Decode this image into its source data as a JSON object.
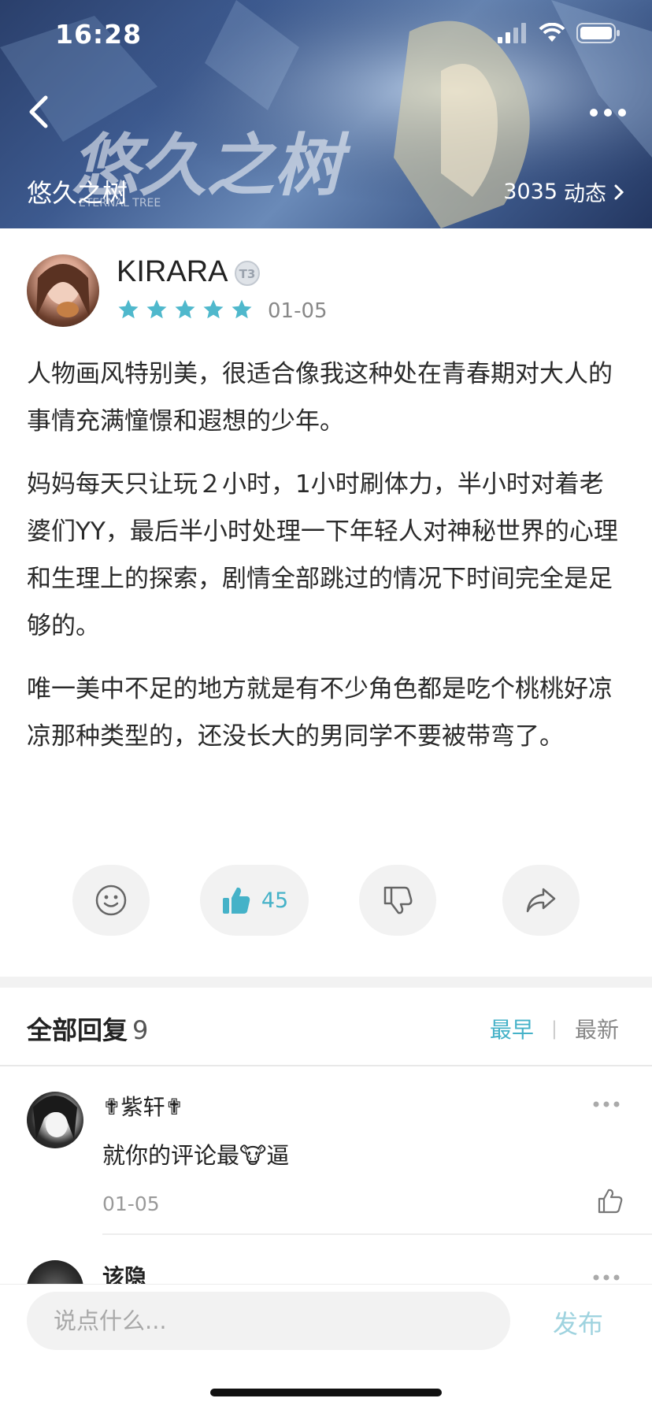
{
  "status_bar": {
    "time": "16:28"
  },
  "header": {
    "game_title": "悠久之树",
    "dynamics_count": "3035",
    "dynamics_label": "动态",
    "banner_logo_text": "悠久之树",
    "banner_logo_subtext": "ETERNAL TREE"
  },
  "post": {
    "author": "KIRARA",
    "level_badge": "T3",
    "rating": 5,
    "date": "01-05",
    "paragraphs": [
      "人物画风特别美，很适合像我这种处在青春期对大人的事情充满憧憬和遐想的少年。",
      "妈妈每天只让玩２小时，1小时刷体力，半小时对着老婆们YY，最后半小时处理一下年轻人对神秘世界的心理和生理上的探索，剧情全部跳过的情况下时间完全是足够的。",
      "唯一美中不足的地方就是有不少角色都是吃个桃桃好凉凉那种类型的，还没长大的男同学不要被带弯了。"
    ],
    "likes": "45"
  },
  "replies": {
    "title": "全部回复",
    "count": "9",
    "sort_earliest": "最早",
    "sort_latest": "最新",
    "items": [
      {
        "name": "✟紫轩✟",
        "text_before": "就你的评论最",
        "emoji": "🐮",
        "text_after": "逼",
        "date": "01-05"
      },
      {
        "name": "该隐"
      }
    ]
  },
  "composer": {
    "placeholder": "说点什么...",
    "publish_label": "发布"
  },
  "colors": {
    "accent": "#45b2c8",
    "star": "#4fb8cc",
    "publish_disabled": "#9fd3df"
  },
  "icons": [
    "back-arrow-icon",
    "more-icon",
    "chevron-right-icon",
    "emoji-icon",
    "thumbs-up-icon",
    "thumbs-down-icon",
    "share-icon",
    "signal-icon",
    "wifi-icon",
    "battery-icon"
  ]
}
